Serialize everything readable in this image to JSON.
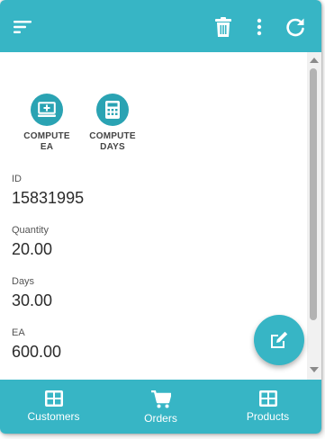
{
  "colors": {
    "primary": "#37b5c5",
    "action_circle": "#2aa3b3",
    "icon": "#ffffff"
  },
  "topbar": {
    "menu_icon": "sort-menu-icon",
    "delete_icon": "trash-icon",
    "more_icon": "more-vertical-icon",
    "refresh_icon": "refresh-icon"
  },
  "actions": [
    {
      "label_line1": "COMPUTE",
      "label_line2": "EA",
      "icon": "add-to-screen-icon"
    },
    {
      "label_line1": "COMPUTE",
      "label_line2": "DAYS",
      "icon": "calculator-icon"
    }
  ],
  "fields": [
    {
      "label": "ID",
      "value": "15831995"
    },
    {
      "label": "Quantity",
      "value": "20.00"
    },
    {
      "label": "Days",
      "value": "30.00"
    },
    {
      "label": "EA",
      "value": "600.00"
    }
  ],
  "fab": {
    "icon": "edit-icon"
  },
  "bottom_nav": [
    {
      "label": "Customers",
      "icon": "grid-icon"
    },
    {
      "label": "Orders",
      "icon": "cart-icon"
    },
    {
      "label": "Products",
      "icon": "grid-icon"
    }
  ]
}
